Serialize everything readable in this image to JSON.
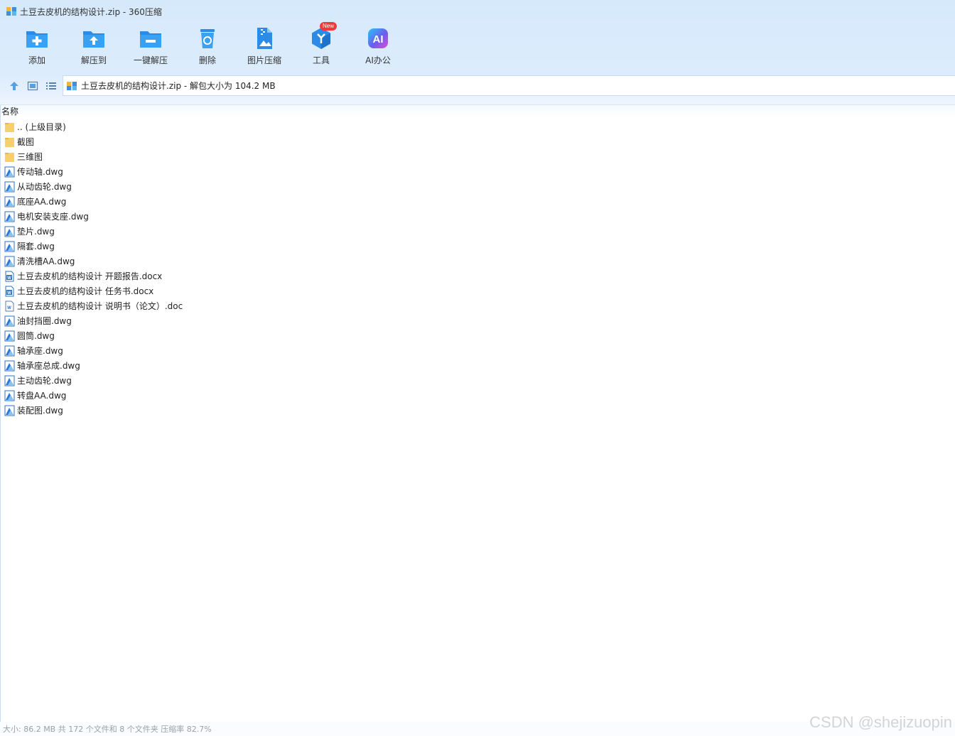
{
  "window": {
    "title": "土豆去皮机的结构设计.zip - 360压缩"
  },
  "toolbar": {
    "items": [
      {
        "label": "添加",
        "icon": "add-icon"
      },
      {
        "label": "解压到",
        "icon": "extract-to-icon"
      },
      {
        "label": "一键解压",
        "icon": "one-click-extract-icon"
      },
      {
        "label": "删除",
        "icon": "delete-icon"
      },
      {
        "label": "图片压缩",
        "icon": "image-compress-icon"
      },
      {
        "label": "工具",
        "icon": "tools-icon",
        "badge": "New"
      },
      {
        "label": "AI办公",
        "icon": "ai-office-icon",
        "glyph": "AI"
      }
    ]
  },
  "address": {
    "text": "土豆去皮机的结构设计.zip - 解包大小为 104.2 MB"
  },
  "columns": {
    "name": "名称"
  },
  "files": [
    {
      "name": ".. (上级目录)",
      "type": "folder"
    },
    {
      "name": "截图",
      "type": "folder"
    },
    {
      "name": "三维图",
      "type": "folder"
    },
    {
      "name": "传动轴.dwg",
      "type": "dwg"
    },
    {
      "name": "从动齿轮.dwg",
      "type": "dwg"
    },
    {
      "name": "底座AA.dwg",
      "type": "dwg"
    },
    {
      "name": "电机安装支座.dwg",
      "type": "dwg"
    },
    {
      "name": "垫片.dwg",
      "type": "dwg"
    },
    {
      "name": "隔套.dwg",
      "type": "dwg"
    },
    {
      "name": "清洗槽AA.dwg",
      "type": "dwg"
    },
    {
      "name": "土豆去皮机的结构设计 开题报告.docx",
      "type": "docx"
    },
    {
      "name": "土豆去皮机的结构设计 任务书.docx",
      "type": "docx"
    },
    {
      "name": "土豆去皮机的结构设计 说明书（论文）.doc",
      "type": "doc"
    },
    {
      "name": "油封挡圈.dwg",
      "type": "dwg"
    },
    {
      "name": "圆筒.dwg",
      "type": "dwg"
    },
    {
      "name": "轴承座.dwg",
      "type": "dwg"
    },
    {
      "name": "轴承座总成.dwg",
      "type": "dwg"
    },
    {
      "name": "主动齿轮.dwg",
      "type": "dwg"
    },
    {
      "name": "转盘AA.dwg",
      "type": "dwg"
    },
    {
      "name": "装配图.dwg",
      "type": "dwg"
    }
  ],
  "status": {
    "text": "大小: 86.2 MB 共 172 个文件和 8 个文件夹 压缩率 82.7%"
  },
  "watermark": {
    "text": "CSDN @shejizuopin"
  },
  "colors": {
    "accent": "#2b8ce8",
    "chrome": "#d9ebfc",
    "folder": "#f7cf6b",
    "badge": "#f03a3a"
  }
}
